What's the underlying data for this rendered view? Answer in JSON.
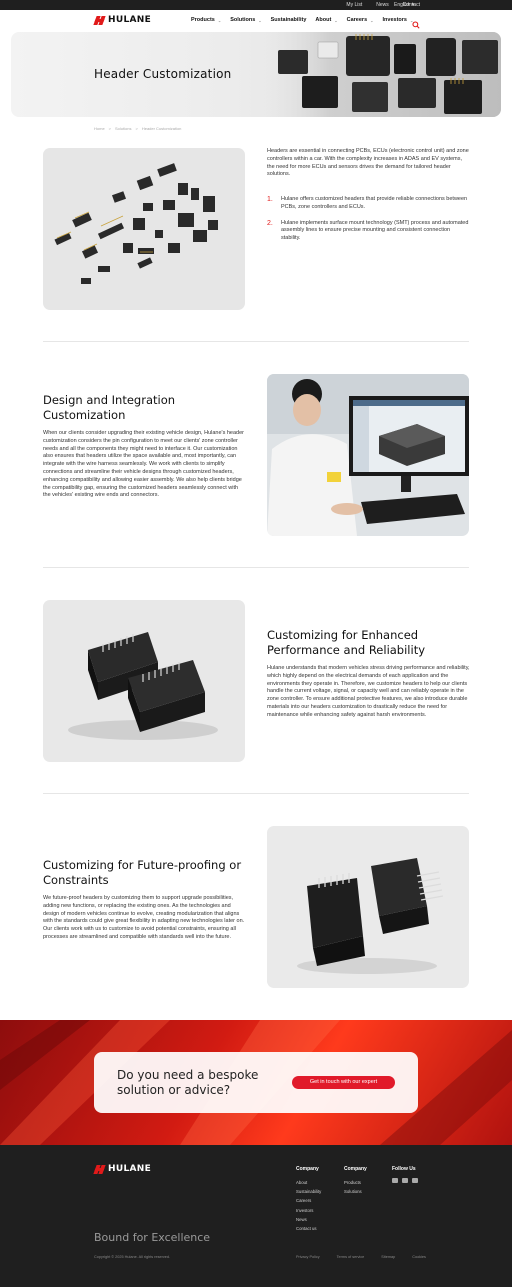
{
  "topbar": {
    "links": [
      "My List",
      "News",
      "Contact"
    ],
    "language": "English"
  },
  "brand": {
    "name": "HULANE",
    "accent": "#e11a1a"
  },
  "nav": {
    "items": [
      "Products",
      "Solutions",
      "Sustainability",
      "About",
      "Careers",
      "Investors"
    ],
    "search_icon": "search-icon"
  },
  "hero": {
    "title": "Header Customization"
  },
  "breadcrumb": [
    "Home",
    "Solutions",
    "Header Customization"
  ],
  "intro": {
    "text": "Headers are essential in connecting PCBs, ECUs (electronic control unit) and zone controllers within a car. With the complexity increases in ADAS and EV systems, the need for more ECUs and sensors drives the demand for tailored header solutions.",
    "points": [
      {
        "num": "1.",
        "text": "Hulane offers customized headers that provide reliable connections between PCBs, zone controllers and ECUs."
      },
      {
        "num": "2.",
        "text": "Hulane implements surface mount technology (SMT) process and automated assembly lines to ensure precise mounting and consistent connection stability."
      }
    ]
  },
  "section1": {
    "title": "Design and Integration Customization",
    "text": "When our clients consider upgrading their existing vehicle design, Hulane's header customization considers the pin configuration to meet our clients' zone controller needs and all the components they might need to interface it. Our customization also ensures that headers utilize the space available and, most importantly, can integrate with the wire harness seamlessly. We work with clients to simplify connections and streamline their vehicle designs through customized headers, enhancing compatibility and allowing easier assembly. We also help clients bridge the compatibility gap, ensuring the customized headers seamlessly connect with the vehicles' existing wire ends and connectors."
  },
  "section2": {
    "title": "Customizing for Enhanced Performance and Reliability",
    "text": "Hulane understands that modern vehicles stress driving performance and reliability, which highly depend on the electrical demands of each application and the environments they operate in. Therefore, we customize headers to help our clients handle the current voltage, signal, or capacity well and can reliably operate in the zone controller. To ensure additional protective features, we also introduce durable materials into our headers customization to drastically reduce the need for maintenance while enhancing safety against harsh environments."
  },
  "section3": {
    "title": "Customizing for Future-proofing or Constraints",
    "text": "We future-proof headers by customizing them to support upgrade possibilities, adding new functions, or replacing the existing ones. As the technologies and design of modern vehicles continue to evolve, creating modularization that aligns with the standards could give great flexibility in adapting new technologies later on. Our clients work with us to customize to avoid potential constraints, ensuring all processes are streamlined and compatible with standards well into the future."
  },
  "cta": {
    "question": "Do you need a bespoke solution or advice?",
    "button": "Get in touch with our expert"
  },
  "footer": {
    "company": {
      "heading": "Company",
      "items": [
        "About",
        "Sustainability",
        "Careers",
        "Investors",
        "News",
        "Contact us"
      ]
    },
    "company2": {
      "heading": "Company",
      "items": [
        "Products",
        "Solutions"
      ]
    },
    "follow": {
      "heading": "Follow Us",
      "icons": [
        "linkedin-icon",
        "wechat-icon",
        "youtube-icon"
      ]
    },
    "tagline": "Bound for Excellence",
    "copyright": "Copyright © 2025 Hulane. All rights reserved.",
    "legal": [
      "Privacy Policy",
      "Terms of service",
      "Sitemap",
      "Cookies"
    ]
  }
}
